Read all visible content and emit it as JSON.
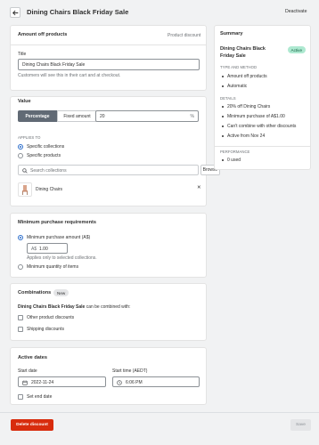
{
  "header": {
    "title": "Dining Chairs Black Friday Sale",
    "deactivate_label": "Deactivate"
  },
  "amount_card": {
    "heading": "Amount off products",
    "type_label": "Product discount",
    "title_label": "Title",
    "title_value": "Dining Chairs Black Friday Sale",
    "help": "Customers will see this in their cart and at checkout."
  },
  "value_card": {
    "heading": "Value",
    "seg_percentage": "Percentage",
    "seg_fixed": "Fixed amount",
    "amount_value": "20",
    "amount_suffix": "%",
    "applies_to_label": "APPLIES TO",
    "opt_collections": "Specific collections",
    "opt_products": "Specific products",
    "search_placeholder": "Search collections",
    "browse_label": "Browse",
    "collection_name": "Dining Chairs",
    "remove_glyph": "✕"
  },
  "min_card": {
    "heading": "Minimum purchase requirements",
    "opt_amount": "Minimum purchase amount (A$)",
    "amount_prefix": "A$",
    "amount_value": "1.00",
    "help": "Applies only to selected collections.",
    "opt_quantity": "Minimum quantity of items"
  },
  "combinations_card": {
    "heading": "Combinations",
    "badge": "New",
    "desc_bold": "Dining Chairs Black Friday Sale",
    "desc_rest": "can be combined with:",
    "opt_product": "Other product discounts",
    "opt_shipping": "Shipping discounts"
  },
  "dates_card": {
    "heading": "Active dates",
    "start_date_label": "Start date",
    "start_date_value": "2022-11-24",
    "start_time_label": "Start time (AEDT)",
    "start_time_value": "6:06 PM",
    "end_date_label": "Set end date"
  },
  "summary": {
    "heading": "Summary",
    "name": "Dining Chairs Black Friday Sale",
    "status": "Active",
    "type_heading": "TYPE AND METHOD",
    "type_items": [
      "Amount off products",
      "Automatic"
    ],
    "details_heading": "DETAILS",
    "details_items": [
      "20% off Dining Chairs",
      "Minimum purchase of A$1.00",
      "Can't combine with other discounts",
      "Active from Nov 24"
    ],
    "performance_heading": "PERFORMANCE",
    "performance_items": [
      "0 used"
    ]
  },
  "footer": {
    "delete_label": "Delete discount",
    "save_label": "Save"
  },
  "colors": {
    "accent": "#2c6ecb",
    "danger": "#d82c0d",
    "active_badge": "#aee9d1",
    "page_bg": "#f1f2f3"
  }
}
